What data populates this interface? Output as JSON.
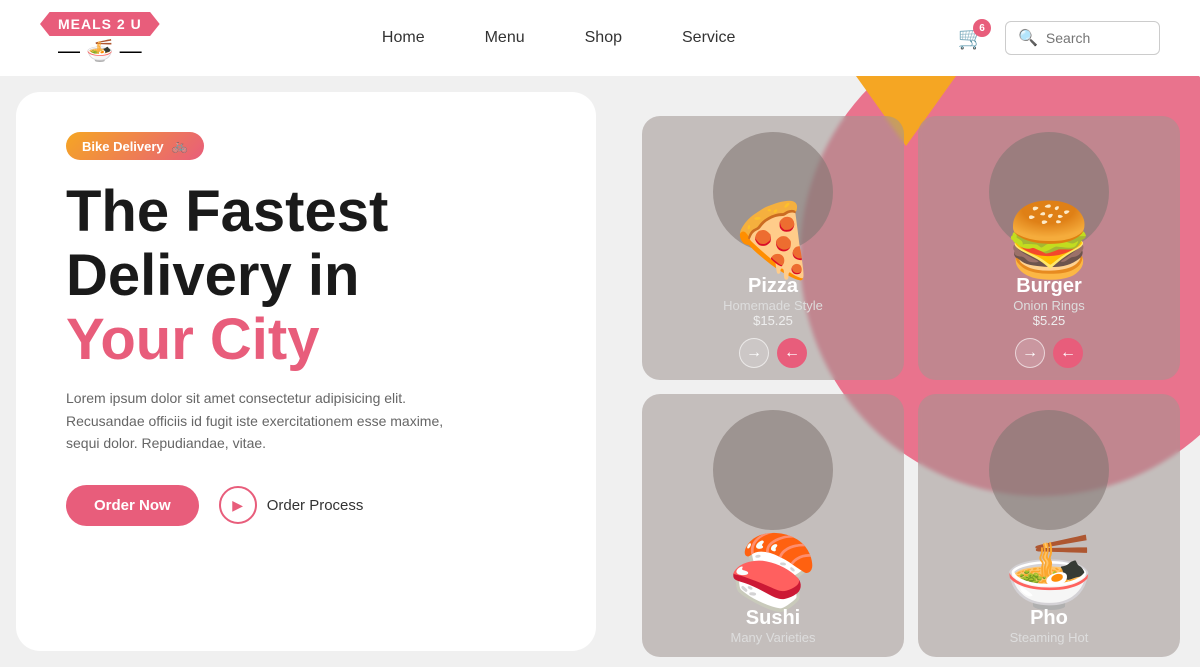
{
  "nav": {
    "logo_text": "Meals 2 U",
    "logo_icon": "🍜",
    "links": [
      "Home",
      "Menu",
      "Shop",
      "Service"
    ],
    "cart_count": "6",
    "search_placeholder": "Search"
  },
  "hero": {
    "badge_label": "Bike Delivery",
    "badge_icon": "🚲",
    "title_line1": "The Fastest",
    "title_line2": "Delivery in",
    "title_line3": "Your City",
    "description": "Lorem ipsum dolor sit amet consectetur adipisicing elit. Recusandae officiis id fugit iste exercitationem esse maxime, sequi dolor. Repudiandae, vitae.",
    "cta_primary": "Order Now",
    "cta_secondary": "Order Process"
  },
  "food_cards": [
    {
      "name": "Pizza",
      "subtitle": "Homemade Style",
      "price": "$15.25",
      "emoji": "🍕"
    },
    {
      "name": "Burger",
      "subtitle": "Onion Rings",
      "price": "$5.25",
      "emoji": "🍔"
    },
    {
      "name": "Sushi",
      "subtitle": "Many Varieties",
      "price": "",
      "emoji": "🍣"
    },
    {
      "name": "Pho",
      "subtitle": "Steaming Hot",
      "price": "",
      "emoji": "🍜"
    }
  ]
}
